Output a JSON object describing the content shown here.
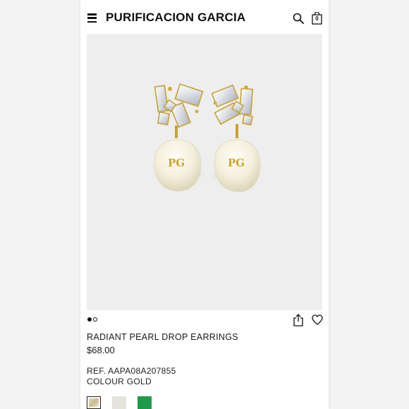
{
  "header": {
    "brand": "PURIFICACION GARCIA",
    "cart_count": "0"
  },
  "gallery": {
    "total_images": 2,
    "active_index": 0,
    "monogram": "PG"
  },
  "product": {
    "title": "RADIANT PEARL DROP EARRINGS",
    "price": "$68.00",
    "ref": "REF. AAPA08A207855",
    "colour": "COLOUR GOLD"
  },
  "swatches": [
    {
      "name": "gold",
      "color": "#d8c9a6",
      "selected": true
    },
    {
      "name": "white",
      "color": "#e4e4dc",
      "selected": false
    },
    {
      "name": "green",
      "color": "#1f9a4a",
      "selected": false
    }
  ],
  "icons": {
    "menu": "hamburger-menu-icon",
    "search": "search-icon",
    "bag": "shopping-bag-icon",
    "share": "share-icon",
    "favorite": "heart-icon"
  }
}
